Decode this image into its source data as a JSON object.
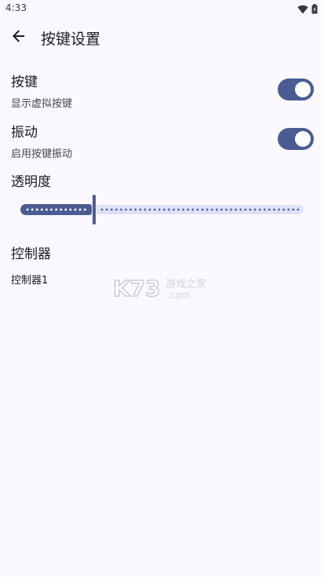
{
  "status_bar": {
    "time": "4:33",
    "icons": [
      "wifi-icon",
      "battery-icon"
    ]
  },
  "app_bar": {
    "title": "按键设置",
    "back_icon": "arrow-back-icon"
  },
  "settings": {
    "keys": {
      "title": "按键",
      "summary": "显示虚拟按键",
      "enabled": true
    },
    "vibration": {
      "title": "振动",
      "summary": "启用按键振动",
      "enabled": true
    },
    "opacity": {
      "title": "透明度",
      "value_fraction": 0.26
    }
  },
  "controllers": {
    "category_title": "控制器",
    "items": [
      "控制器1"
    ]
  },
  "watermark": {
    "text": "K73 游戏之家 .com"
  },
  "colors": {
    "primary": "#4a5c92",
    "track_inactive": "#dde1f9",
    "background": "#fbf8ff",
    "on_surface": "#1b1b21",
    "on_surface_variant": "#44464f"
  }
}
